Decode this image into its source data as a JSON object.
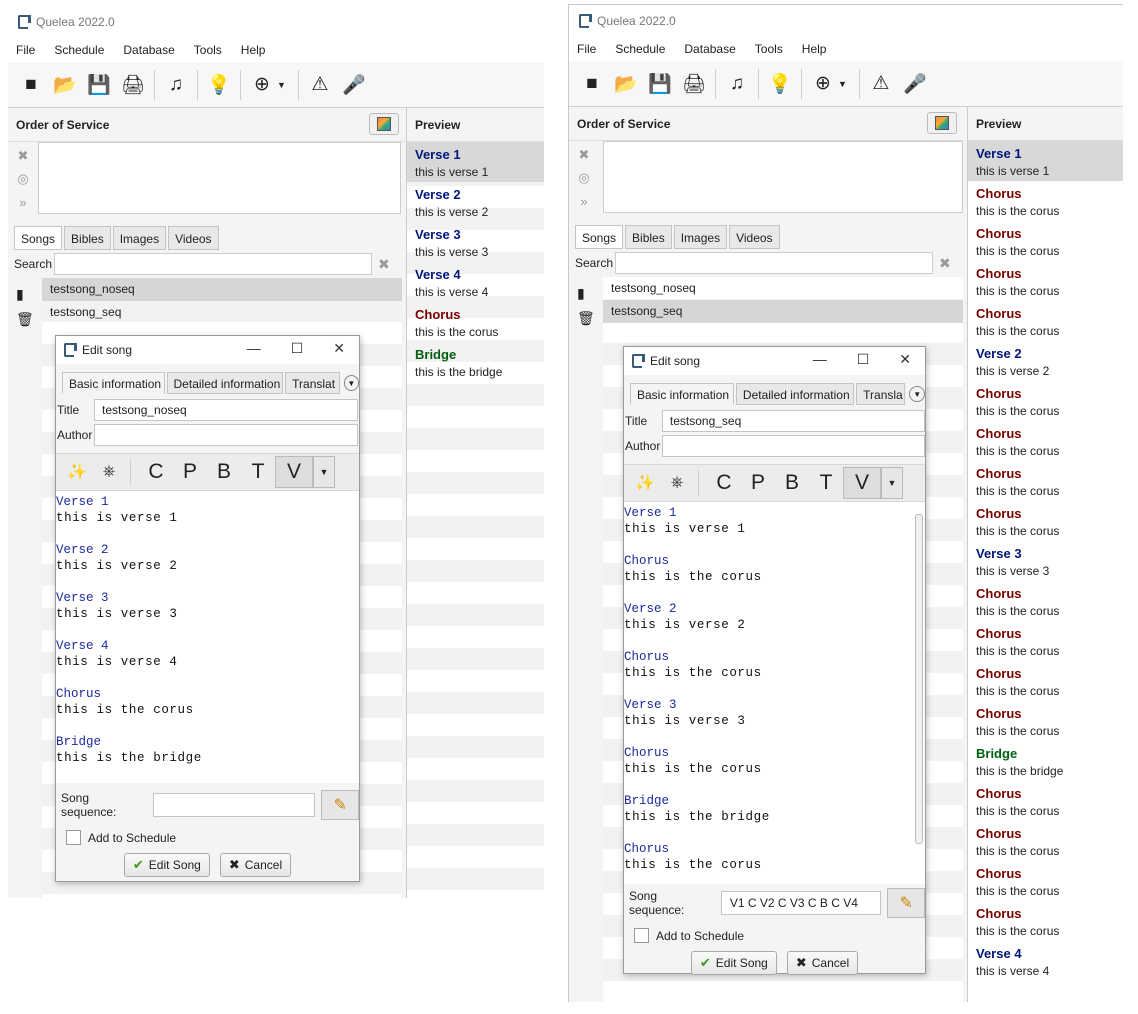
{
  "app": {
    "title": "Quelea 2022.0"
  },
  "menu": [
    "File",
    "Schedule",
    "Database",
    "Tools",
    "Help"
  ],
  "oos": {
    "title": "Order of Service"
  },
  "library": {
    "tabs": [
      "Songs",
      "Bibles",
      "Images",
      "Videos"
    ],
    "search_label": "Search"
  },
  "preview": {
    "title": "Preview"
  },
  "left": {
    "songs": [
      "testsong_noseq",
      "testsong_seq"
    ],
    "preview": [
      {
        "title": "Verse 1",
        "body": "this is verse 1",
        "kind": "verse"
      },
      {
        "title": "Verse 2",
        "body": "this is verse 2",
        "kind": "verse"
      },
      {
        "title": "Verse 3",
        "body": "this is verse 3",
        "kind": "verse"
      },
      {
        "title": "Verse 4",
        "body": "this is verse 4",
        "kind": "verse"
      },
      {
        "title": "Chorus",
        "body": "this is the corus",
        "kind": "chorus"
      },
      {
        "title": "Bridge",
        "body": "this is the bridge",
        "kind": "bridge"
      }
    ],
    "dialog": {
      "title": "Edit song",
      "tabs": [
        "Basic information",
        "Detailed information",
        "Translat"
      ],
      "title_label": "Title",
      "title_value": "testsong_noseq",
      "author_label": "Author",
      "author_value": "",
      "lyrics": [
        [
          "Verse 1",
          "this is verse 1"
        ],
        [
          "Verse 2",
          "this is verse 2"
        ],
        [
          "Verse 3",
          "this is verse 3"
        ],
        [
          "Verse 4",
          "this is verse 4"
        ],
        [
          "Chorus",
          "this is the corus"
        ],
        [
          "Bridge",
          "this is the bridge"
        ]
      ],
      "seq_label": "Song sequence:",
      "seq_value": "",
      "add_label": "Add to Schedule",
      "edit_label": "Edit Song",
      "cancel_label": "Cancel"
    }
  },
  "right": {
    "songs": [
      "testsong_noseq",
      "testsong_seq"
    ],
    "preview": [
      {
        "title": "Verse 1",
        "body": "this is verse 1",
        "kind": "verse"
      },
      {
        "title": "Chorus",
        "body": "this is the corus",
        "kind": "chorus"
      },
      {
        "title": "Chorus",
        "body": "this is the corus",
        "kind": "chorus"
      },
      {
        "title": "Chorus",
        "body": "this is the corus",
        "kind": "chorus"
      },
      {
        "title": "Chorus",
        "body": "this is the corus",
        "kind": "chorus"
      },
      {
        "title": "Verse 2",
        "body": "this is verse 2",
        "kind": "verse"
      },
      {
        "title": "Chorus",
        "body": "this is the corus",
        "kind": "chorus"
      },
      {
        "title": "Chorus",
        "body": "this is the corus",
        "kind": "chorus"
      },
      {
        "title": "Chorus",
        "body": "this is the corus",
        "kind": "chorus"
      },
      {
        "title": "Chorus",
        "body": "this is the corus",
        "kind": "chorus"
      },
      {
        "title": "Verse 3",
        "body": "this is verse 3",
        "kind": "verse"
      },
      {
        "title": "Chorus",
        "body": "this is the corus",
        "kind": "chorus"
      },
      {
        "title": "Chorus",
        "body": "this is the corus",
        "kind": "chorus"
      },
      {
        "title": "Chorus",
        "body": "this is the corus",
        "kind": "chorus"
      },
      {
        "title": "Chorus",
        "body": "this is the corus",
        "kind": "chorus"
      },
      {
        "title": "Bridge",
        "body": "this is the bridge",
        "kind": "bridge"
      },
      {
        "title": "Chorus",
        "body": "this is the corus",
        "kind": "chorus"
      },
      {
        "title": "Chorus",
        "body": "this is the corus",
        "kind": "chorus"
      },
      {
        "title": "Chorus",
        "body": "this is the corus",
        "kind": "chorus"
      },
      {
        "title": "Chorus",
        "body": "this is the corus",
        "kind": "chorus"
      },
      {
        "title": "Verse 4",
        "body": "this is verse 4",
        "kind": "verse"
      }
    ],
    "dialog": {
      "title": "Edit song",
      "tabs": [
        "Basic information",
        "Detailed information",
        "Transla"
      ],
      "title_label": "Title",
      "title_value": "testsong_seq",
      "author_label": "Author",
      "author_value": "",
      "lyrics": [
        [
          "Verse 1",
          "this is verse 1"
        ],
        [
          "Chorus",
          "this is the corus"
        ],
        [
          "Verse 2",
          "this is verse 2"
        ],
        [
          "Chorus",
          "this is the corus"
        ],
        [
          "Verse 3",
          "this is verse 3"
        ],
        [
          "Chorus",
          "this is the corus"
        ],
        [
          "Bridge",
          "this is the bridge"
        ],
        [
          "Chorus",
          "this is the corus"
        ]
      ],
      "seq_label": "Song sequence:",
      "seq_value": "V1 C V2 C V3 C B C V4",
      "add_label": "Add to Schedule",
      "edit_label": "Edit Song",
      "cancel_label": "Cancel"
    }
  },
  "icons": [
    "new-icon",
    "open-icon",
    "save-icon",
    "print-icon",
    "song-icon",
    "bulb-icon",
    "add-icon",
    "warning-icon",
    "mic-icon"
  ],
  "format_buttons": [
    "C",
    "P",
    "B",
    "T",
    "V"
  ],
  "colors": {
    "verse": "#00167a",
    "chorus": "#7a0000",
    "bridge": "#006010",
    "selection": "#d6d6d6"
  }
}
